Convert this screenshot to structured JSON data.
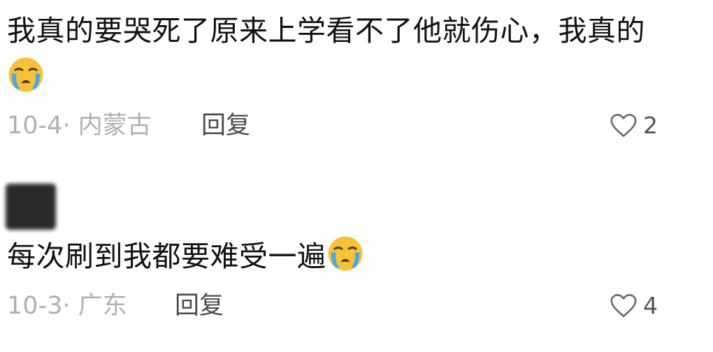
{
  "comments": [
    {
      "text_line1": "我真的要哭死了原来上学看不了他就伤心，我真的",
      "emoji": "loudly-crying-face",
      "date": "10-4",
      "location": "内蒙古",
      "reply_label": "回复",
      "likes": "2"
    },
    {
      "text": "每次刷到我都要难受一遍",
      "emoji": "loudly-crying-face",
      "date": "10-3",
      "location": "广东",
      "reply_label": "回复",
      "likes": "4"
    }
  ],
  "separator": "·",
  "colors": {
    "text": "#111111",
    "meta": "#b0b0b0",
    "reply": "#4a4a4a",
    "emoji_face": "#f6c338",
    "emoji_tears": "#4aa8e8"
  }
}
